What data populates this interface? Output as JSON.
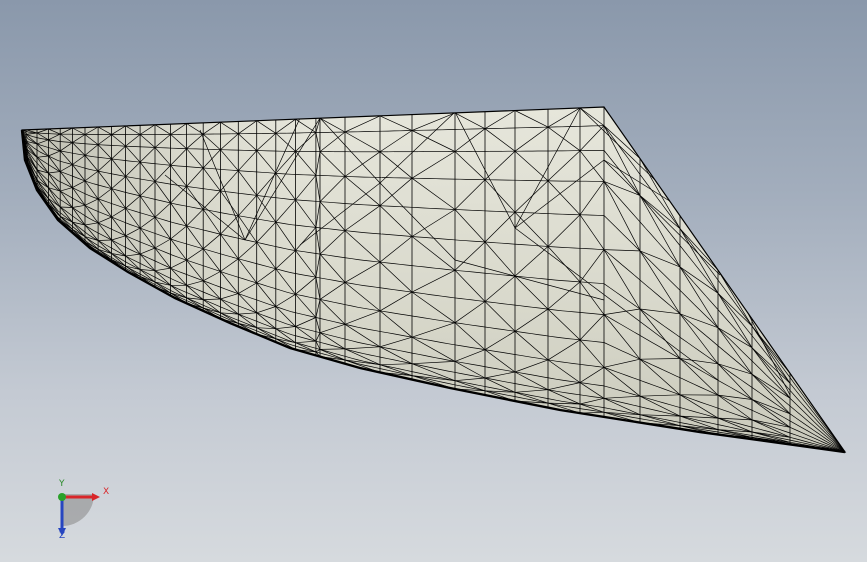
{
  "viewport": {
    "background_top": "#8a98ab",
    "background_bottom": "#d6dade"
  },
  "model": {
    "kind": "triangulated surface mesh",
    "fill_color": "#dcdccf",
    "edge_color": "#000000"
  },
  "triad": {
    "x_label": "X",
    "y_label": "Y",
    "z_label": "Z",
    "x_color": "#d8262a",
    "y_color": "#2a8a2a",
    "z_color": "#2746c0"
  }
}
